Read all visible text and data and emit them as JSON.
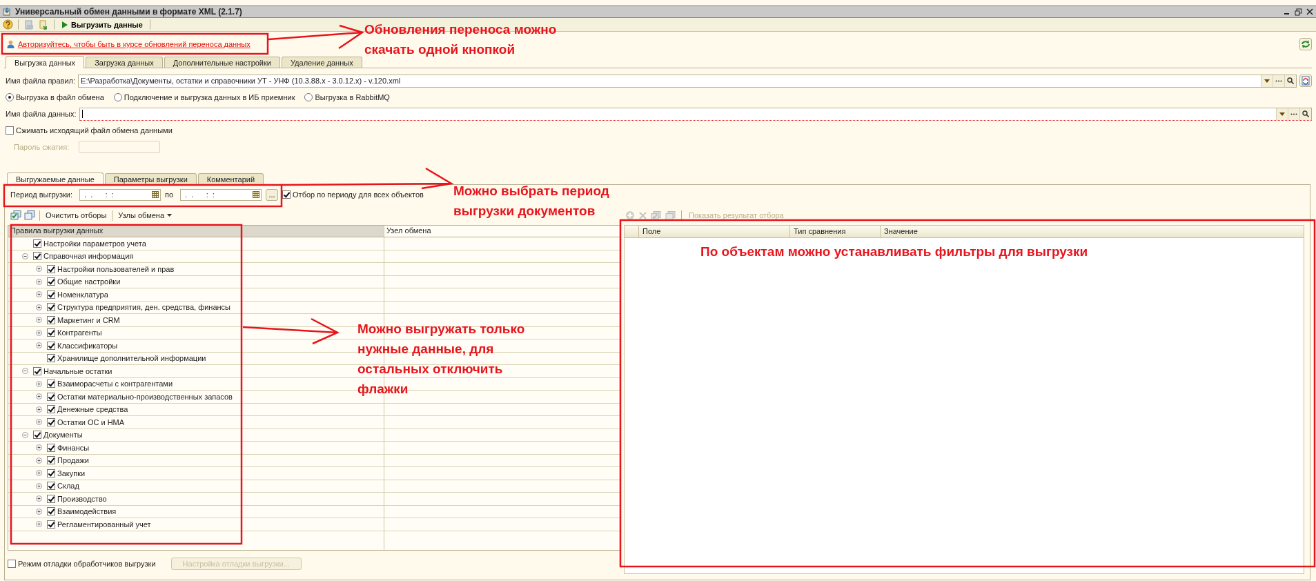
{
  "window": {
    "title": "Универсальный обмен данными в формате XML (2.1.7)"
  },
  "toolbar": {
    "export_button": "Выгрузить данные"
  },
  "auth_link": "Авторизуйтесь, чтобы быть в курсе обновлений переноса данных",
  "tabs": [
    {
      "label": "Выгрузка данных",
      "selected": true
    },
    {
      "label": "Загрузка данных",
      "selected": false
    },
    {
      "label": "Дополнительные настройки",
      "selected": false
    },
    {
      "label": "Удаление данных",
      "selected": false
    }
  ],
  "rules_file": {
    "label": "Имя файла правил:",
    "value": "E:\\Разработка\\Документы, остатки и справочники УТ - УНФ (10.3.88.x - 3.0.12.x) - v.120.xml"
  },
  "export_modes": [
    {
      "label": "Выгрузка в файл обмена",
      "selected": true
    },
    {
      "label": "Подключение и выгрузка данных в ИБ приемник",
      "selected": false
    },
    {
      "label": "Выгрузка в RabbitMQ",
      "selected": false
    }
  ],
  "data_file": {
    "label": "Имя файла данных:"
  },
  "compress": {
    "label": "Сжимать исходящий файл обмена данными",
    "checked": false
  },
  "password": {
    "label": "Пароль сжатия:",
    "disabled": true
  },
  "inner_tabs": [
    {
      "label": "Выгружаемые данные",
      "selected": true
    },
    {
      "label": "Параметры выгрузки",
      "selected": false
    },
    {
      "label": "Комментарий",
      "selected": false
    }
  ],
  "period": {
    "label": "Период выгрузки:",
    "from": " .  .      :  :",
    "separator": "по",
    "to": " .  .      :  :",
    "more_button": "...",
    "filter_all": {
      "label": "Отбор по периоду для всех объектов",
      "checked": true
    }
  },
  "rules_toolbar": {
    "clear_filters": "Очистить отборы",
    "nodes_menu": "Узлы обмена"
  },
  "rules_table": {
    "columns": [
      "Правила выгрузки данных",
      "Узел обмена"
    ],
    "rows": [
      {
        "label": "Настройки параметров учета",
        "checked": true,
        "has_children": false,
        "expanded": false
      },
      {
        "label": "Справочная информация",
        "checked": true,
        "has_children": true,
        "expanded": true,
        "children": [
          {
            "label": "Настройки пользователей и прав",
            "checked": true,
            "has_children": true,
            "expanded": false
          },
          {
            "label": "Общие настройки",
            "checked": true,
            "has_children": true,
            "expanded": false
          },
          {
            "label": "Номенклатура",
            "checked": true,
            "has_children": true,
            "expanded": false
          },
          {
            "label": "Структура предприятия, ден. средства, финансы",
            "checked": true,
            "has_children": true,
            "expanded": false
          },
          {
            "label": "Маркетинг и CRM",
            "checked": true,
            "has_children": true,
            "expanded": false
          },
          {
            "label": "Контрагенты",
            "checked": true,
            "has_children": true,
            "expanded": false
          },
          {
            "label": "Классификаторы",
            "checked": true,
            "has_children": true,
            "expanded": false
          },
          {
            "label": "Хранилище дополнительной информации",
            "checked": true,
            "has_children": false,
            "expanded": false
          }
        ]
      },
      {
        "label": "Начальные остатки",
        "checked": true,
        "has_children": true,
        "expanded": true,
        "children": [
          {
            "label": "Взаиморасчеты с контрагентами",
            "checked": true,
            "has_children": true,
            "expanded": false
          },
          {
            "label": "Остатки материально-производственных запасов",
            "checked": true,
            "has_children": true,
            "expanded": false
          },
          {
            "label": "Денежные средства",
            "checked": true,
            "has_children": true,
            "expanded": false
          },
          {
            "label": "Остатки ОС и НМА",
            "checked": true,
            "has_children": true,
            "expanded": false
          }
        ]
      },
      {
        "label": "Документы",
        "checked": true,
        "has_children": true,
        "expanded": true,
        "children": [
          {
            "label": "Финансы",
            "checked": true,
            "has_children": true,
            "expanded": false
          },
          {
            "label": "Продажи",
            "checked": true,
            "has_children": true,
            "expanded": false
          },
          {
            "label": "Закупки",
            "checked": true,
            "has_children": true,
            "expanded": false
          },
          {
            "label": "Склад",
            "checked": true,
            "has_children": true,
            "expanded": false
          },
          {
            "label": "Производство",
            "checked": true,
            "has_children": true,
            "expanded": false
          },
          {
            "label": "Взаимодействия",
            "checked": true,
            "has_children": true,
            "expanded": false
          },
          {
            "label": "Регламентированный учет",
            "checked": true,
            "has_children": true,
            "expanded": false
          }
        ]
      }
    ]
  },
  "filter_toolbar": {
    "show_result": "Показать результат отбора",
    "disabled": true
  },
  "filter_table": {
    "columns": [
      "Поле",
      "Тип сравнения",
      "Значение"
    ]
  },
  "debug": {
    "label": "Режим отладки обработчиков выгрузки",
    "checked": false,
    "settings_button": "Настройка отладки выгрузки...",
    "button_disabled": true
  },
  "annotations": [
    {
      "lines": [
        "Обновления переноса можно",
        "скачать одной кнопкой"
      ]
    },
    {
      "lines": [
        "Можно выбрать период",
        "выгрузки документов"
      ]
    },
    {
      "lines": [
        "Можно выгружать только",
        "нужные данные, для",
        "остальных отключить",
        "флажки"
      ]
    },
    {
      "lines": [
        "По объектам можно устанавливать фильтры для выгрузки"
      ]
    }
  ]
}
